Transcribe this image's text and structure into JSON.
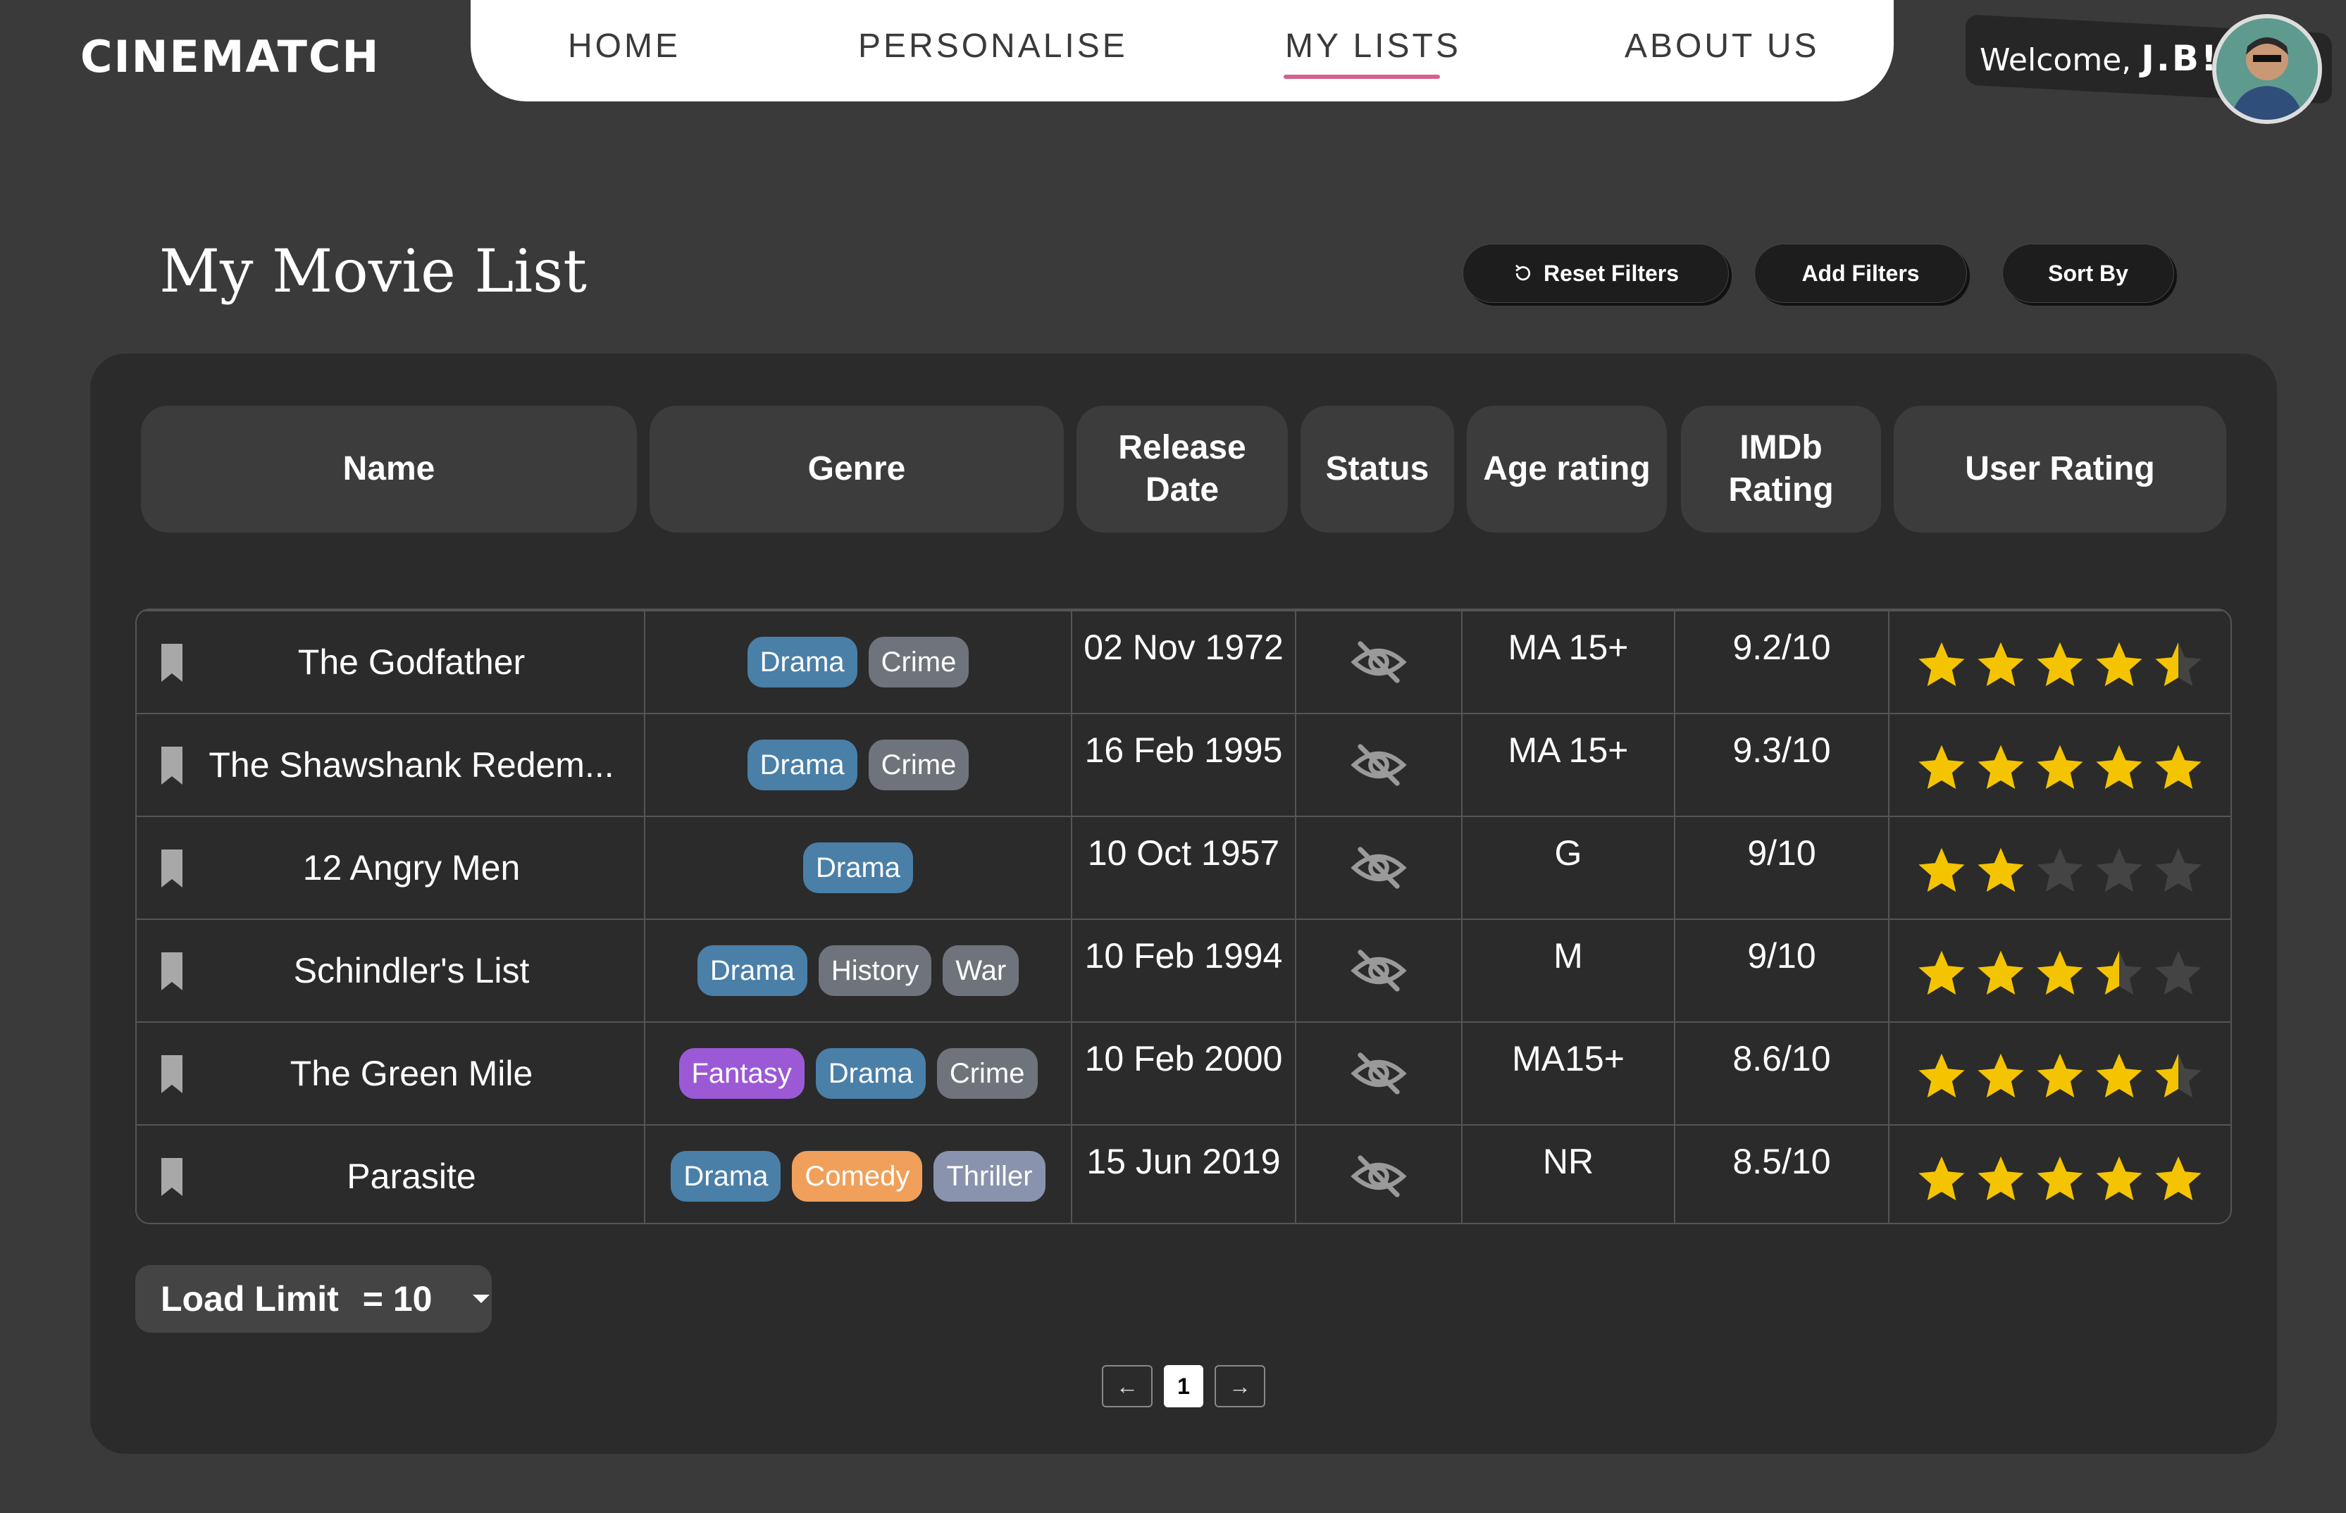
{
  "header": {
    "brand": "CINEMATCH",
    "nav": [
      {
        "label": "HOME"
      },
      {
        "label": "PERSONALISE"
      },
      {
        "label": "MY LISTS"
      },
      {
        "label": "ABOUT US"
      }
    ],
    "active_nav": "MY LISTS",
    "welcome_prefix": "Welcome,",
    "user_name": "J.B!"
  },
  "page": {
    "title": "My Movie List",
    "buttons": {
      "reset": "Reset Filters",
      "add": "Add Filters",
      "sort": "Sort By"
    }
  },
  "table": {
    "columns": [
      "Name",
      "Genre",
      "Release Date",
      "Status",
      "Age rating",
      "IMDb Rating",
      "User Rating"
    ],
    "rows": [
      {
        "name": "The Godfather",
        "genres": [
          "Drama",
          "Crime"
        ],
        "release": "02 Nov 1972",
        "status": "not-watched",
        "age": "MA 15+",
        "imdb": "9.2/10",
        "user_rating": 4.5
      },
      {
        "name": "The Shawshank Redem...",
        "genres": [
          "Drama",
          "Crime"
        ],
        "release": "16 Feb 1995",
        "status": "not-watched",
        "age": "MA 15+",
        "imdb": "9.3/10",
        "user_rating": 5
      },
      {
        "name": "12 Angry Men",
        "genres": [
          "Drama"
        ],
        "release": "10 Oct 1957",
        "status": "not-watched",
        "age": "G",
        "imdb": "9/10",
        "user_rating": 2
      },
      {
        "name": "Schindler's List",
        "genres": [
          "Drama",
          "History",
          "War"
        ],
        "release": "10 Feb 1994",
        "status": "not-watched",
        "age": "M",
        "imdb": "9/10",
        "user_rating": 3.5
      },
      {
        "name": "The Green Mile",
        "genres": [
          "Fantasy",
          "Drama",
          "Crime"
        ],
        "release": "10 Feb 2000",
        "status": "not-watched",
        "age": "MA15+",
        "imdb": "8.6/10",
        "user_rating": 4.5
      },
      {
        "name": "Parasite",
        "genres": [
          "Drama",
          "Comedy",
          "Thriller"
        ],
        "release": "15 Jun 2019",
        "status": "not-watched",
        "age": "NR",
        "imdb": "8.5/10",
        "user_rating": 5
      }
    ]
  },
  "genre_colors": {
    "Drama": "#4a7fa8",
    "Crime": "#6f737b",
    "History": "#6f737b",
    "War": "#6f737b",
    "Fantasy": "#9b59d6",
    "Comedy": "#f0a05a",
    "Thriller": "#8a93ad"
  },
  "colors": {
    "star_filled": "#f5c400",
    "star_empty": "#444444",
    "nav_underline": "#d4608f"
  },
  "footer": {
    "load_label": "Load Limit",
    "load_value": "= 10",
    "pagination": {
      "prev": "←",
      "current": "1",
      "next": "→"
    }
  }
}
